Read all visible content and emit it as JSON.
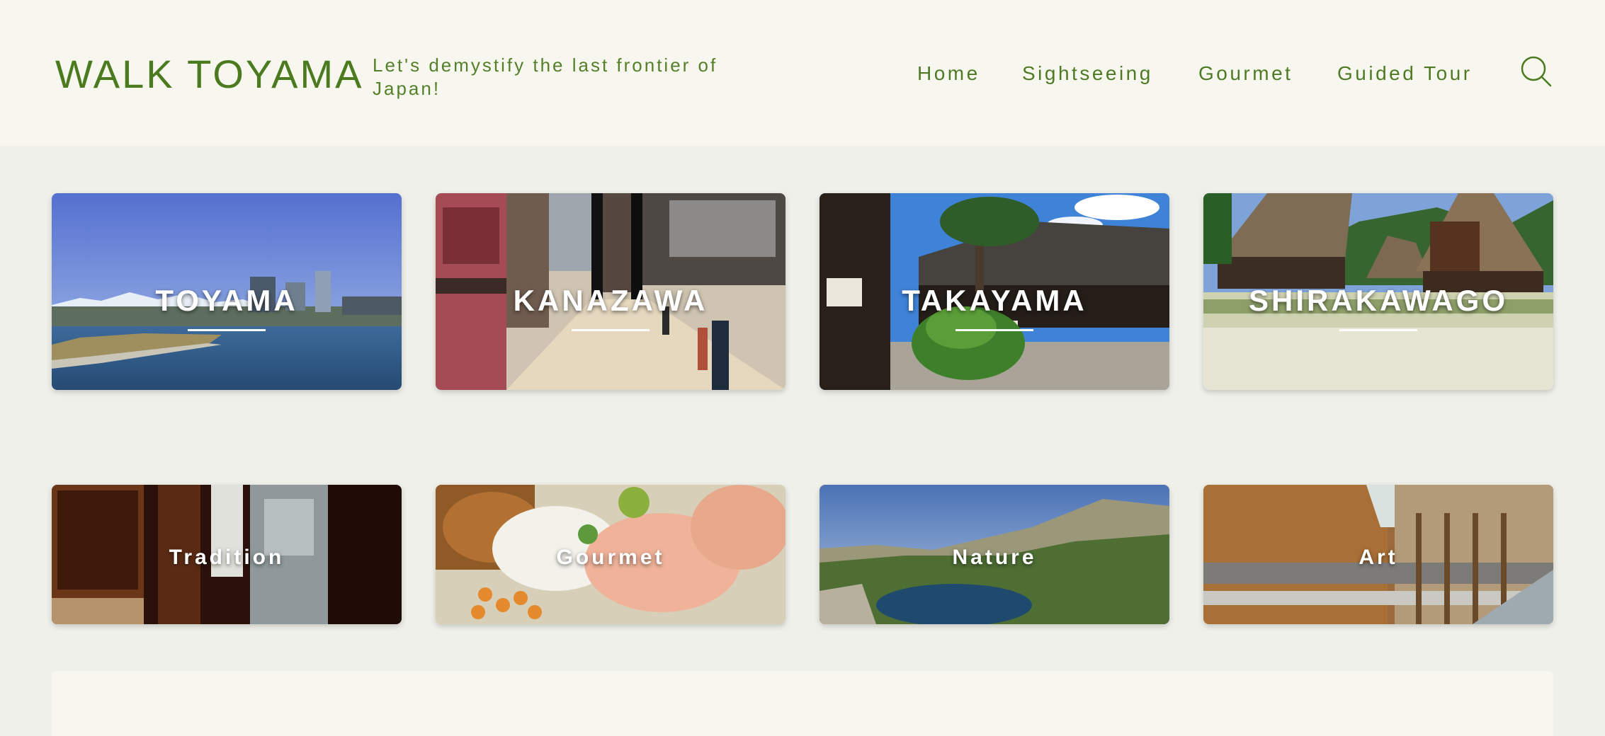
{
  "header": {
    "site_title": "WALK TOYAMA",
    "tagline": "Let's demystify the last frontier of Japan!",
    "nav": [
      "Home",
      "Sightseeing",
      "Gourmet",
      "Guided Tour"
    ],
    "search_icon": "search-icon"
  },
  "destinations": [
    {
      "label": "TOYAMA"
    },
    {
      "label": "KANAZAWA"
    },
    {
      "label": "TAKAYAMA"
    },
    {
      "label": "SHIRAKAWAGO"
    }
  ],
  "themes": [
    {
      "label": "Tradition"
    },
    {
      "label": "Gourmet"
    },
    {
      "label": "Nature"
    },
    {
      "label": "Art"
    }
  ],
  "colors": {
    "accent_green": "#4b7a1f",
    "header_bg": "#f7f7ef",
    "page_bg": "#f0f0ea"
  }
}
